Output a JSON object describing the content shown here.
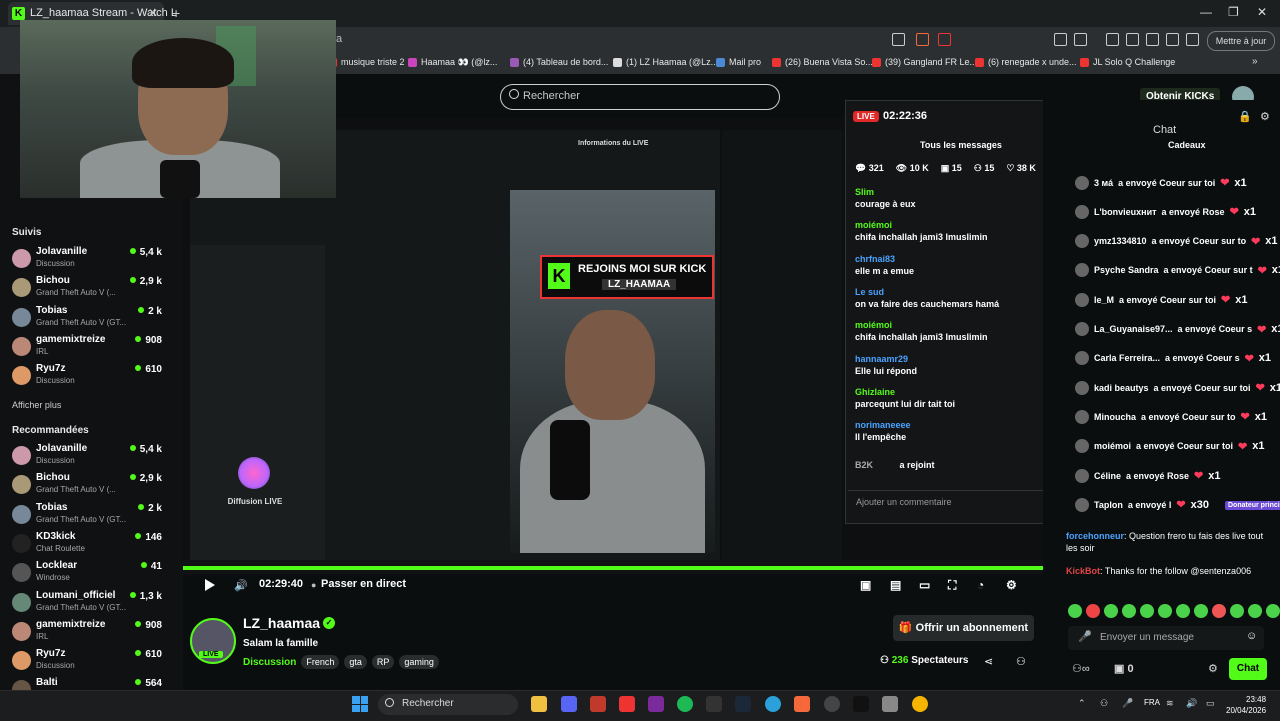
{
  "browser": {
    "tab_title": "LZ_haamaa Stream - Watch L",
    "address": "a",
    "update_button": "Mettre à jour",
    "bookmarks": [
      {
        "label": "musique triste 2",
        "color": "#e33"
      },
      {
        "label": "Haamaa 👀 (@lz...",
        "color": "#c4b"
      },
      {
        "label": "(4) Tableau de bord...",
        "color": "#9b59b6"
      },
      {
        "label": "(1) LZ Haamaa (@Lz...",
        "color": "#ddd"
      },
      {
        "label": "Mail pro",
        "color": "#4a8ad4"
      },
      {
        "label": "(26) Buena Vista So...",
        "color": "#e33"
      },
      {
        "label": "(39) Gangland FR Le...",
        "color": "#e33"
      },
      {
        "label": "(6) renegade x unde...",
        "color": "#e33"
      },
      {
        "label": "JL Solo Q Challenge",
        "color": "#e33"
      }
    ]
  },
  "header": {
    "search_placeholder": "Rechercher",
    "kicks_button": "Obtenir KICKs"
  },
  "sidebar": {
    "follows_title": "Suivis",
    "show_more": "Afficher plus",
    "recommended_title": "Recommandées",
    "follows": [
      {
        "name": "Jolavanille",
        "category": "Discussion",
        "viewers": "5,4 k",
        "color": "#c9a"
      },
      {
        "name": "Bichou",
        "category": "Grand Theft Auto V (...",
        "viewers": "2,9 k",
        "color": "#a97"
      },
      {
        "name": "Tobias",
        "category": "Grand Theft Auto V (GT...",
        "viewers": "2 k",
        "color": "#789"
      },
      {
        "name": "gamemixtreize",
        "category": "IRL",
        "viewers": "908",
        "color": "#b87"
      },
      {
        "name": "Ryu7z",
        "category": "Discussion",
        "viewers": "610",
        "color": "#d96"
      }
    ],
    "recommended": [
      {
        "name": "Jolavanille",
        "category": "Discussion",
        "viewers": "5,4 k",
        "color": "#c9a"
      },
      {
        "name": "Bichou",
        "category": "Grand Theft Auto V (...",
        "viewers": "2,9 k",
        "color": "#a97"
      },
      {
        "name": "Tobias",
        "category": "Grand Theft Auto V (GT...",
        "viewers": "2 k",
        "color": "#789"
      },
      {
        "name": "KD3kick",
        "category": "Chat Roulette",
        "viewers": "146",
        "color": "#222"
      },
      {
        "name": "Locklear",
        "category": "Windrose",
        "viewers": "41",
        "color": "#555"
      },
      {
        "name": "Loumani_officiel",
        "category": "Grand Theft Auto V (GT...",
        "viewers": "1,3 k",
        "color": "#687"
      },
      {
        "name": "gamemixtreize",
        "category": "IRL",
        "viewers": "908",
        "color": "#b87"
      },
      {
        "name": "Ryu7z",
        "category": "Discussion",
        "viewers": "610",
        "color": "#d96"
      },
      {
        "name": "Balti",
        "category": "",
        "viewers": "564",
        "color": "#654"
      }
    ]
  },
  "video": {
    "inner_title": "Informations du LIVE",
    "banner_line1": "REJOINS MOI SUR KICK",
    "banner_line2": "LZ_HAAMAA",
    "diffusion_title": "Diffusion LIVE",
    "elapsed": "02:29:40",
    "go_live": "Passer en direct"
  },
  "live_chat_overlay": {
    "live_badge": "LIVE",
    "time": "02:22:36",
    "title": "Tous les messages",
    "stats": [
      "321",
      "10 K",
      "15",
      "15",
      "38 K"
    ],
    "messages": [
      {
        "user": "Slim",
        "text": "courage à eux",
        "color": "#53fc18"
      },
      {
        "user": "moiémoi",
        "text": "chifa inchallah jami3 lmuslimin",
        "color": "#53fc18"
      },
      {
        "user": "chrfnai83",
        "text": "elle m a emue",
        "color": "#4aa3ff"
      },
      {
        "user": "Le sud",
        "text": "on va faire des cauchemars hamá",
        "color": "#4aa3ff"
      },
      {
        "user": "moiémoi",
        "text": "chifa inchallah jami3 lmuslimin",
        "color": "#53fc18"
      },
      {
        "user": "hannaamr29",
        "text": "Elle lui répond",
        "color": "#4aa3ff"
      },
      {
        "user": "Ghizlaine",
        "text": "parcequnt lui dir tait toi",
        "color": "#53fc18"
      },
      {
        "user": "norimaneeee",
        "text": "Il l'empêche",
        "color": "#4aa3ff"
      }
    ],
    "joined_user": "B2K",
    "joined_text": "a rejoint",
    "input_placeholder": "Ajouter un commentaire"
  },
  "right_chat": {
    "title": "Chat",
    "gifts_title": "Cadeaux",
    "gifts": [
      {
        "user": "3 мá",
        "text": "a envoyé Coeur sur toi",
        "count": "x1"
      },
      {
        "user": "L'bonvieuxнит",
        "text": "a envoyé Rose",
        "count": "x1"
      },
      {
        "user": "ymz1334810",
        "text": "a envoyé Coeur sur to",
        "count": "x1"
      },
      {
        "user": "Psyche Sandra",
        "text": "a envoyé Coeur sur t",
        "count": "x1"
      },
      {
        "user": "le_M",
        "text": "a envoyé Coeur sur toi",
        "count": "x1"
      },
      {
        "user": "La_Guyanaise97...",
        "text": "a envoyé Coeur s",
        "count": "x1"
      },
      {
        "user": "Carla Ferreira...",
        "text": "a envoyé Coeur s",
        "count": "x1"
      },
      {
        "user": "kadi beautys",
        "text": "a envoyé Coeur sur toi",
        "count": "x1"
      },
      {
        "user": "Minoucha",
        "text": "a envoyé Coeur sur to",
        "count": "x1"
      },
      {
        "user": "moiémoi",
        "text": "a envoyé Coeur sur toi",
        "count": "x1"
      },
      {
        "user": "Céline",
        "text": "a envoyé Rose",
        "count": "x1"
      },
      {
        "user": "Taplon",
        "text": "a envoyé l",
        "count": "x30"
      }
    ],
    "donor_badge": "Donateur princip",
    "messages": [
      {
        "user": "forcehonneur",
        "text": "Question frero tu fais des live tout les soir",
        "color": "#4aa3ff"
      },
      {
        "user": "KickBot",
        "text": "Thanks for the follow @sentenza006",
        "color": "#e04545"
      }
    ],
    "input_placeholder": "Envoyer un message",
    "points": "0",
    "send_button": "Chat"
  },
  "channel": {
    "name": "LZ_haamaa",
    "live_badge": "LIVE",
    "subtitle": "Salam la famille",
    "category": "Discussion",
    "tags": [
      "French",
      "gta",
      "RP",
      "gaming"
    ],
    "subscribe_button": "Offrir un abonnement",
    "viewers": "236",
    "viewers_label": "Spectateurs"
  },
  "taskbar": {
    "search_placeholder": "Rechercher",
    "lang": "FRA",
    "time": "23:48",
    "date": "20/04/2026"
  }
}
